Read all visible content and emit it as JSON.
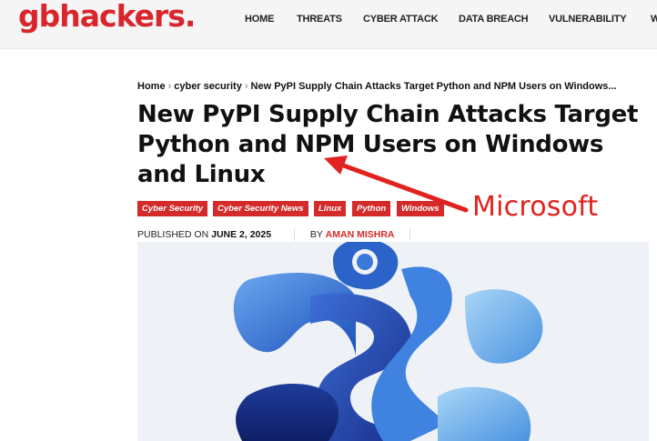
{
  "site": {
    "logo": "gbhackers."
  },
  "nav": [
    {
      "label": "HOME"
    },
    {
      "label": "THREATS"
    },
    {
      "label": "CYBER ATTACK"
    },
    {
      "label": "DATA BREACH"
    },
    {
      "label": "VULNERABILITY"
    },
    {
      "label": "W"
    }
  ],
  "breadcrumb": {
    "home": "Home",
    "category": "cyber security",
    "current": "New PyPI Supply Chain Attacks Target Python and NPM Users on Windows...",
    "separator": "›"
  },
  "article": {
    "title": "New PyPI Supply Chain Attacks Target Python and NPM Users on Windows and Linux",
    "tags": [
      "Cyber Security",
      "Cyber Security News",
      "Linux",
      "Python",
      "Windows"
    ],
    "published_prefix": "PUBLISHED ON",
    "published_date": "JUNE 2, 2025",
    "by_prefix": "BY",
    "author": "AMAN MISHRA"
  },
  "annotation": {
    "label": "Microsoft",
    "color": "#e0231f"
  },
  "colors": {
    "brand": "#d9262c",
    "tag_bg": "#d42a2a",
    "hero_blue": "#2f6fd6"
  },
  "icons": {
    "hero": "python-logo-abstract-image"
  }
}
